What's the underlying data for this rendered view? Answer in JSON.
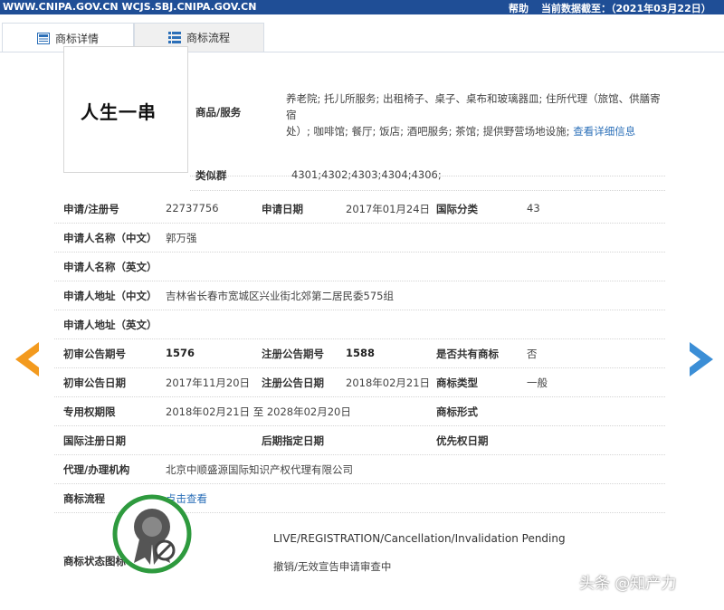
{
  "topbar": {
    "domains": "WWW.CNIPA.GOV.CN WCJS.SBJ.CNIPA.GOV.CN",
    "help": "帮助",
    "date_text": "当前数据截至：（2021年03月22日）"
  },
  "tabs": [
    {
      "label": "商标详情",
      "icon": "document-icon",
      "active": true
    },
    {
      "label": "商标流程",
      "icon": "list-icon",
      "active": false
    }
  ],
  "trademark": {
    "image_text": "人生一串",
    "goods_label": "商品/服务",
    "goods_value": "养老院; 托儿所服务; 出租椅子、桌子、桌布和玻璃器皿; 住所代理（旅馆、供膳寄宿",
    "goods_value2": "处）; 咖啡馆; 餐厅; 饭店; 酒吧服务; 茶馆; 提供野营场地设施;",
    "goods_more_link": "查看详细信息",
    "similar_label": "类似群",
    "similar_value": "4301;4302;4303;4304;4306;"
  },
  "fields": {
    "reg_no_label": "申请/注册号",
    "reg_no": "22737756",
    "apply_date_label": "申请日期",
    "apply_date": "2017年01月24日",
    "intl_class_label": "国际分类",
    "intl_class": "43",
    "applicant_cn_label": "申请人名称（中文）",
    "applicant_cn": "郭万强",
    "applicant_en_label": "申请人名称（英文）",
    "address_cn_label": "申请人地址（中文）",
    "address_cn": "吉林省长春市宽城区兴业街北郊第二居民委575组",
    "address_en_label": "申请人地址（英文）",
    "prelim_no_label": "初审公告期号",
    "prelim_no": "1576",
    "reg_pub_no_label": "注册公告期号",
    "reg_pub_no": "1588",
    "shared_label": "是否共有商标",
    "shared": "否",
    "prelim_date_label": "初审公告日期",
    "prelim_date": "2017年11月20日",
    "reg_pub_date_label": "注册公告日期",
    "reg_pub_date": "2018年02月21日",
    "tm_type_label": "商标类型",
    "tm_type": "一般",
    "exclusive_label": "专用权期限",
    "exclusive": "2018年02月21日 至 2028年02月20日",
    "tm_form_label": "商标形式",
    "intl_reg_date_label": "国际注册日期",
    "later_date_label": "后期指定日期",
    "priority_date_label": "优先权日期",
    "agent_label": "代理/办理机构",
    "agent": "北京中顺盛源国际知识产权代理有限公司",
    "process_label": "商标流程",
    "process_link": "点击查看",
    "status_label": "商标状态图标",
    "status_en": "LIVE/REGISTRATION/Cancellation/Invalidation Pending",
    "status_cn": "撤销/无效宣告申请审查中"
  },
  "watermark": "头条 @知产力",
  "colors": {
    "topbar": "#1f4e96",
    "arrow_left": "#f39a1e",
    "arrow_right": "#3b8ed6",
    "status_ring": "#2e9a3e",
    "link": "#2b6fb8"
  }
}
